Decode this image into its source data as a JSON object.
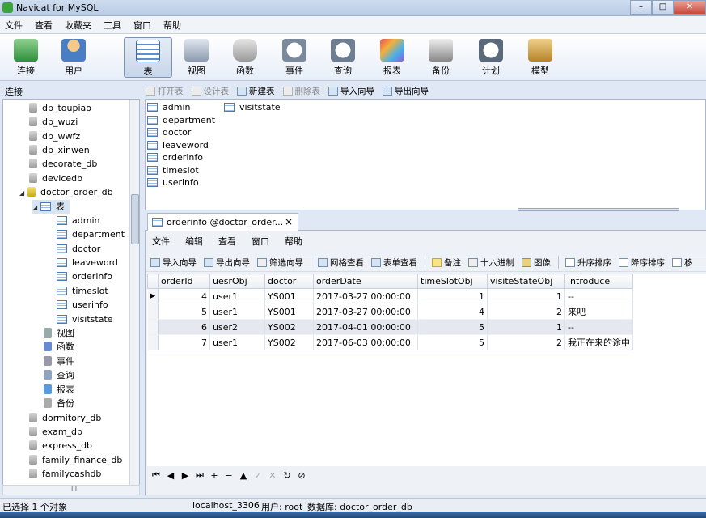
{
  "window": {
    "title": "Navicat for MySQL"
  },
  "menu": [
    "文件",
    "查看",
    "收藏夹",
    "工具",
    "窗口",
    "帮助"
  ],
  "toolbar": [
    "连接",
    "用户",
    "表",
    "视图",
    "函数",
    "事件",
    "查询",
    "报表",
    "备份",
    "计划",
    "模型"
  ],
  "toolbar_active": "表",
  "left_header": "连接",
  "tree": {
    "dbs_before": [
      "db_toupiao",
      "db_wuzi",
      "db_wwfz",
      "db_xinwen",
      "decorate_db",
      "devicedb"
    ],
    "open_db": "doctor_order_db",
    "tables_node": "表",
    "tables": [
      "admin",
      "department",
      "doctor",
      "leaveword",
      "orderinfo",
      "timeslot",
      "userinfo",
      "visitstate"
    ],
    "other_nodes": [
      "视图",
      "函数",
      "事件",
      "查询",
      "报表",
      "备份"
    ],
    "dbs_after": [
      "dormitory_db",
      "exam_db",
      "express_db",
      "family_finance_db",
      "familycashdb"
    ],
    "hscroll_label": "III"
  },
  "object_toolbar": [
    {
      "label": "打开表",
      "enabled": false
    },
    {
      "label": "设计表",
      "enabled": false
    },
    {
      "label": "新建表",
      "enabled": true
    },
    {
      "label": "删除表",
      "enabled": false
    },
    {
      "label": "导入向导",
      "enabled": true
    },
    {
      "label": "导出向导",
      "enabled": true
    }
  ],
  "object_list": {
    "col1": [
      "admin",
      "department",
      "doctor",
      "leaveword",
      "orderinfo",
      "timeslot",
      "userinfo"
    ],
    "col2": [
      "visitstate"
    ]
  },
  "tab": {
    "label": "orderinfo @doctor_order...",
    "close": "×"
  },
  "inner_menu": [
    "文件",
    "编辑",
    "查看",
    "窗口",
    "帮助"
  ],
  "inner_toolbar": [
    "导入向导",
    "导出向导",
    "筛选向导",
    "网格查看",
    "表单查看",
    "备注",
    "十六进制",
    "图像",
    "升序排序",
    "降序排序",
    "移"
  ],
  "grid": {
    "columns": [
      "orderId",
      "uesrObj",
      "doctor",
      "orderDate",
      "timeSlotObj",
      "visiteStateObj",
      "introduce"
    ],
    "rows": [
      [
        "4",
        "user1",
        "YS001",
        "2017-03-27 00:00:00",
        "1",
        "1",
        "--"
      ],
      [
        "5",
        "user1",
        "YS001",
        "2017-03-27 00:00:00",
        "4",
        "2",
        "来吧"
      ],
      [
        "6",
        "user2",
        "YS002",
        "2017-04-01 00:00:00",
        "5",
        "1",
        "--"
      ],
      [
        "7",
        "user1",
        "YS002",
        "2017-06-03 00:00:00",
        "5",
        "2",
        "我正在来的途中"
      ]
    ],
    "current_row_marker": "▶"
  },
  "navbar": [
    "⏮",
    "◀",
    "▶",
    "⏭",
    "+",
    "−",
    "▲",
    "✓",
    "✕",
    "↻",
    "⊘"
  ],
  "status": {
    "selection": "已选择 1 个对象",
    "host": "localhost_3306",
    "user": "用户: root",
    "db": "数据库: doctor_order_db"
  }
}
